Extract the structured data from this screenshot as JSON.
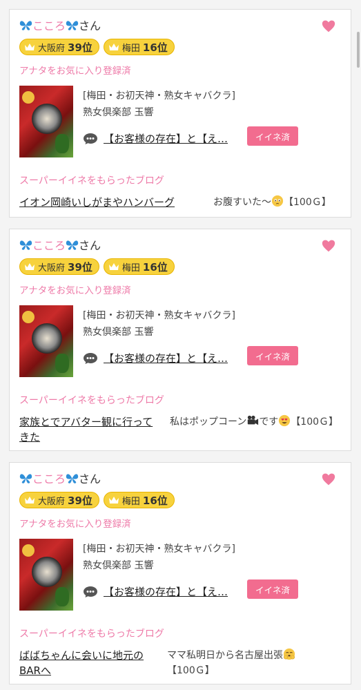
{
  "cards": [
    {
      "user_name": "こころ",
      "user_suffix": "さん",
      "badge_area_label": "大阪府",
      "badge_area_rank": "39位",
      "badge_city_label": "梅田",
      "badge_city_rank": "16位",
      "favorite_status": "アナタをお気に入り登録済",
      "shop_category": "[梅田・お初天神・熟女キャバクラ]",
      "shop_name": "熟女倶楽部 玉響",
      "blog_title": "【お客様の存在】と【え…",
      "ine_button": "イイネ済",
      "super_ine_label": "スーパーイイネをもらったブログ",
      "post_title": "イオン岡崎いしがまやハンバーグ",
      "comment_before": "お腹すいた〜",
      "comment_after": "【100Ｇ】"
    },
    {
      "user_name": "こころ",
      "user_suffix": "さん",
      "badge_area_label": "大阪府",
      "badge_area_rank": "39位",
      "badge_city_label": "梅田",
      "badge_city_rank": "16位",
      "favorite_status": "アナタをお気に入り登録済",
      "shop_category": "[梅田・お初天神・熟女キャバクラ]",
      "shop_name": "熟女倶楽部 玉響",
      "blog_title": "【お客様の存在】と【え…",
      "ine_button": "イイネ済",
      "super_ine_label": "スーパーイイネをもらったブログ",
      "post_title": "家族とでアバター観に行ってきた",
      "comment_before": "私はポップコーン",
      "comment_mid": "です",
      "comment_after": "【100Ｇ】"
    },
    {
      "user_name": "こころ",
      "user_suffix": "さん",
      "badge_area_label": "大阪府",
      "badge_area_rank": "39位",
      "badge_city_label": "梅田",
      "badge_city_rank": "16位",
      "favorite_status": "アナタをお気に入り登録済",
      "shop_category": "[梅田・お初天神・熟女キャバクラ]",
      "shop_name": "熟女倶楽部 玉響",
      "blog_title": "【お客様の存在】と【え…",
      "ine_button": "イイネ済",
      "super_ine_label": "スーパーイイネをもらったブログ",
      "post_title": "ばばちゃんに会いに地元のBARへ",
      "comment_before": "ママ私明日から名古屋出張",
      "comment_after": "【100Ｇ】"
    }
  ],
  "colors": {
    "pink": "#ee7aa8",
    "badge": "#f7d23d",
    "ine": "#f26c8f",
    "butterfly": "#2f8fd8"
  },
  "icons": [
    "butterfly-icon",
    "heart-icon",
    "crown-icon",
    "chat-icon",
    "emoji-icon",
    "video-camera-icon"
  ]
}
